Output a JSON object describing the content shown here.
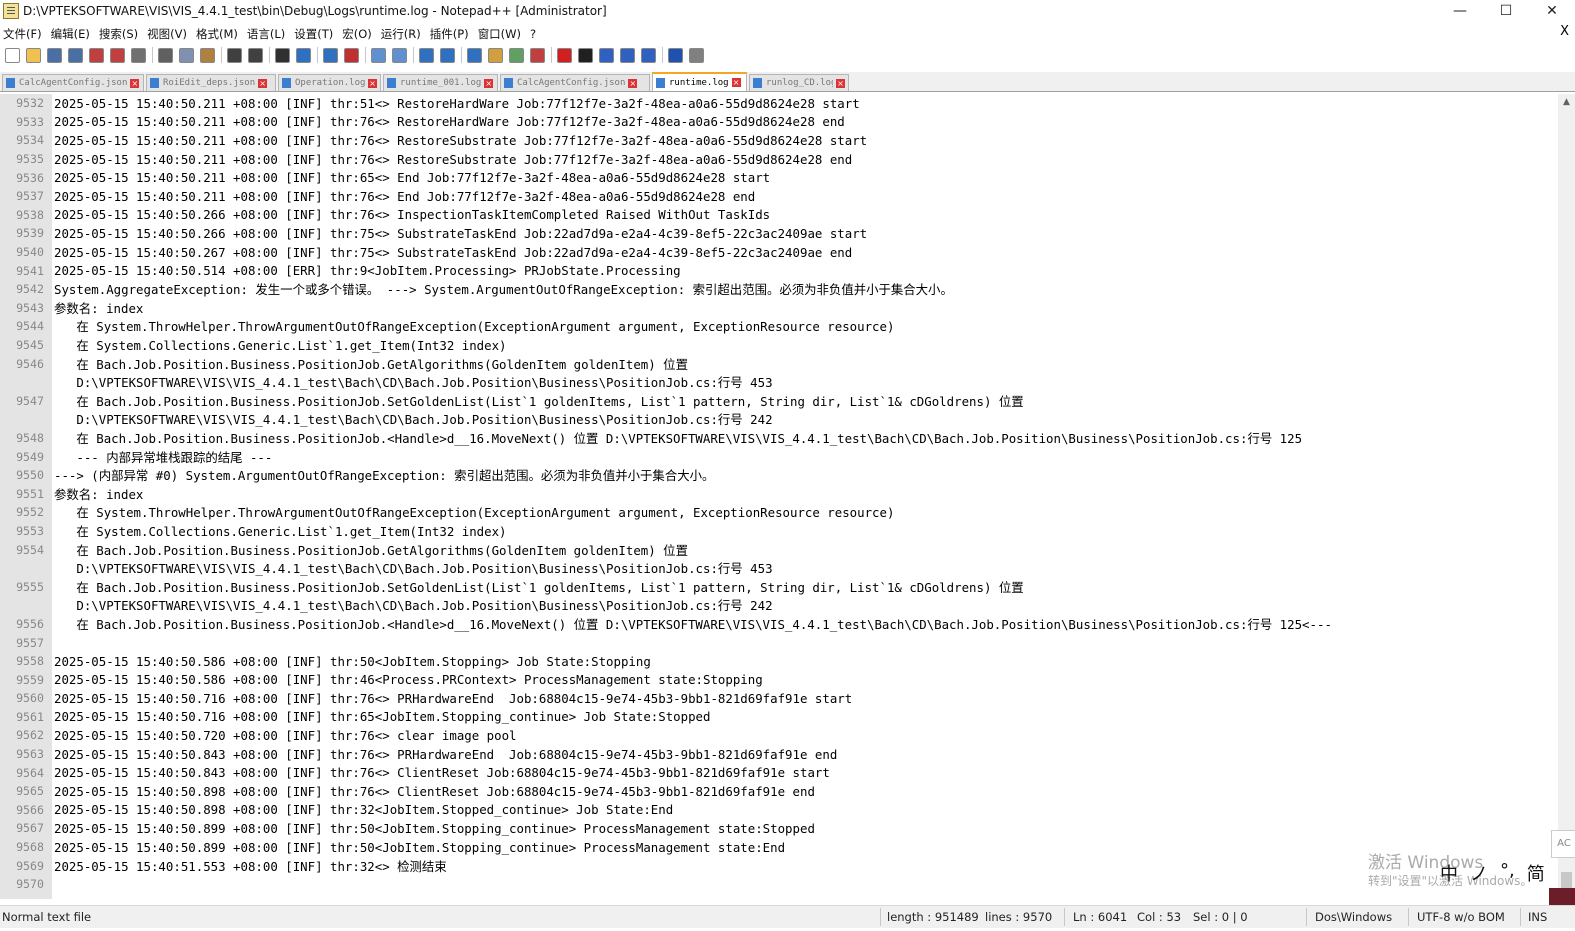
{
  "window": {
    "title": "D:\\VPTEKSOFTWARE\\VIS\\VIS_4.4.1_test\\bin\\Debug\\Logs\\runtime.log - Notepad++ [Administrator]",
    "minimize": "—",
    "maximize": "☐",
    "close": "✕"
  },
  "menu": [
    "文件(F)",
    "编辑(E)",
    "搜索(S)",
    "视图(V)",
    "格式(M)",
    "语言(L)",
    "设置(T)",
    "宏(O)",
    "运行(R)",
    "插件(P)",
    "窗口(W)",
    "?"
  ],
  "menu_close": "X",
  "toolbar": [
    {
      "icon": "new-file-icon",
      "color": "#ffffff"
    },
    {
      "icon": "open-file-icon",
      "color": "#f0c050"
    },
    {
      "icon": "save-icon",
      "color": "#4a6fa5"
    },
    {
      "icon": "save-all-icon",
      "color": "#4a6fa5"
    },
    {
      "icon": "close-file-icon",
      "color": "#c04040"
    },
    {
      "icon": "close-all-icon",
      "color": "#c04040"
    },
    {
      "icon": "print-icon",
      "color": "#707070"
    },
    {
      "icon": "sep"
    },
    {
      "icon": "cut-icon",
      "color": "#606060"
    },
    {
      "icon": "copy-icon",
      "color": "#8090b0"
    },
    {
      "icon": "paste-icon",
      "color": "#b08040"
    },
    {
      "icon": "sep"
    },
    {
      "icon": "undo-icon",
      "color": "#404040"
    },
    {
      "icon": "redo-icon",
      "color": "#404040"
    },
    {
      "icon": "sep"
    },
    {
      "icon": "find-icon",
      "color": "#303030"
    },
    {
      "icon": "replace-icon",
      "color": "#3070c0"
    },
    {
      "icon": "sep"
    },
    {
      "icon": "zoom-in-icon",
      "color": "#3070c0"
    },
    {
      "icon": "zoom-out-icon",
      "color": "#c03030"
    },
    {
      "icon": "sep"
    },
    {
      "icon": "sync-vertical-icon",
      "color": "#6090d0"
    },
    {
      "icon": "sync-horizontal-icon",
      "color": "#6090d0"
    },
    {
      "icon": "sep"
    },
    {
      "icon": "word-wrap-icon",
      "color": "#3070c0"
    },
    {
      "icon": "show-all-chars-icon",
      "color": "#3070c0"
    },
    {
      "icon": "sep"
    },
    {
      "icon": "indent-guide-icon",
      "color": "#3070c0"
    },
    {
      "icon": "udl-icon",
      "color": "#d0a040"
    },
    {
      "icon": "doc-map-icon",
      "color": "#60a060"
    },
    {
      "icon": "function-list-icon",
      "color": "#c04040"
    },
    {
      "icon": "sep"
    },
    {
      "icon": "record-macro-icon",
      "color": "#d02020"
    },
    {
      "icon": "stop-macro-icon",
      "color": "#202020"
    },
    {
      "icon": "play-macro-icon",
      "color": "#3060c0"
    },
    {
      "icon": "run-macro-multiple-icon",
      "color": "#3060c0"
    },
    {
      "icon": "save-macro-icon",
      "color": "#3060c0"
    },
    {
      "icon": "sep"
    },
    {
      "icon": "spellcheck-icon",
      "color": "#2050b0"
    },
    {
      "icon": "plugin-icon",
      "color": "#808080"
    }
  ],
  "tabs": [
    {
      "label": "CalcAgentConfig.json",
      "active": false
    },
    {
      "label": "RoiEdit_deps.json",
      "active": false
    },
    {
      "label": "Operation.log",
      "active": false
    },
    {
      "label": "runtime_001.log",
      "active": false
    },
    {
      "label": "CalcAgentConfig.json",
      "active": false
    },
    {
      "label": "runtime.log",
      "active": true
    },
    {
      "label": "runlog_CD.log",
      "active": false
    }
  ],
  "lines": [
    {
      "n": "9532",
      "t": "2025-05-15 15:40:50.211 +08:00 [INF] thr:51<> RestoreHardWare Job:77f12f7e-3a2f-48ea-a0a6-55d9d8624e28 start"
    },
    {
      "n": "9533",
      "t": "2025-05-15 15:40:50.211 +08:00 [INF] thr:76<> RestoreHardWare Job:77f12f7e-3a2f-48ea-a0a6-55d9d8624e28 end"
    },
    {
      "n": "9534",
      "t": "2025-05-15 15:40:50.211 +08:00 [INF] thr:76<> RestoreSubstrate Job:77f12f7e-3a2f-48ea-a0a6-55d9d8624e28 start"
    },
    {
      "n": "9535",
      "t": "2025-05-15 15:40:50.211 +08:00 [INF] thr:76<> RestoreSubstrate Job:77f12f7e-3a2f-48ea-a0a6-55d9d8624e28 end"
    },
    {
      "n": "9536",
      "t": "2025-05-15 15:40:50.211 +08:00 [INF] thr:65<> End Job:77f12f7e-3a2f-48ea-a0a6-55d9d8624e28 start"
    },
    {
      "n": "9537",
      "t": "2025-05-15 15:40:50.211 +08:00 [INF] thr:76<> End Job:77f12f7e-3a2f-48ea-a0a6-55d9d8624e28 end"
    },
    {
      "n": "9538",
      "t": "2025-05-15 15:40:50.266 +08:00 [INF] thr:76<> InspectionTaskItemCompleted Raised WithOut TaskIds"
    },
    {
      "n": "9539",
      "t": "2025-05-15 15:40:50.266 +08:00 [INF] thr:75<> SubstrateTaskEnd Job:22ad7d9a-e2a4-4c39-8ef5-22c3ac2409ae start"
    },
    {
      "n": "9540",
      "t": "2025-05-15 15:40:50.267 +08:00 [INF] thr:75<> SubstrateTaskEnd Job:22ad7d9a-e2a4-4c39-8ef5-22c3ac2409ae end"
    },
    {
      "n": "9541",
      "t": "2025-05-15 15:40:50.514 +08:00 [ERR] thr:9<JobItem.Processing> PRJobState.Processing"
    },
    {
      "n": "9542",
      "t": "System.AggregateException: 发生一个或多个错误。 ---> System.ArgumentOutOfRangeException: 索引超出范围。必须为非负值并小于集合大小。"
    },
    {
      "n": "9543",
      "t": "参数名: index"
    },
    {
      "n": "9544",
      "t": "   在 System.ThrowHelper.ThrowArgumentOutOfRangeException(ExceptionArgument argument, ExceptionResource resource)"
    },
    {
      "n": "9545",
      "t": "   在 System.Collections.Generic.List`1.get_Item(Int32 index)"
    },
    {
      "n": "9546",
      "t": "   在 Bach.Job.Position.Business.PositionJob.GetAlgorithms(GoldenItem goldenItem) 位置"
    },
    {
      "n": "",
      "t": "   D:\\VPTEKSOFTWARE\\VIS\\VIS_4.4.1_test\\Bach\\CD\\Bach.Job.Position\\Business\\PositionJob.cs:行号 453"
    },
    {
      "n": "9547",
      "t": "   在 Bach.Job.Position.Business.PositionJob.SetGoldenList(List`1 goldenItems, List`1 pattern, String dir, List`1& cDGoldrens) 位置"
    },
    {
      "n": "",
      "t": "   D:\\VPTEKSOFTWARE\\VIS\\VIS_4.4.1_test\\Bach\\CD\\Bach.Job.Position\\Business\\PositionJob.cs:行号 242"
    },
    {
      "n": "9548",
      "t": "   在 Bach.Job.Position.Business.PositionJob.<Handle>d__16.MoveNext() 位置 D:\\VPTEKSOFTWARE\\VIS\\VIS_4.4.1_test\\Bach\\CD\\Bach.Job.Position\\Business\\PositionJob.cs:行号 125"
    },
    {
      "n": "9549",
      "t": "   --- 内部异常堆栈跟踪的结尾 ---"
    },
    {
      "n": "9550",
      "t": "---> (内部异常 #0) System.ArgumentOutOfRangeException: 索引超出范围。必须为非负值并小于集合大小。"
    },
    {
      "n": "9551",
      "t": "参数名: index"
    },
    {
      "n": "9552",
      "t": "   在 System.ThrowHelper.ThrowArgumentOutOfRangeException(ExceptionArgument argument, ExceptionResource resource)"
    },
    {
      "n": "9553",
      "t": "   在 System.Collections.Generic.List`1.get_Item(Int32 index)"
    },
    {
      "n": "9554",
      "t": "   在 Bach.Job.Position.Business.PositionJob.GetAlgorithms(GoldenItem goldenItem) 位置"
    },
    {
      "n": "",
      "t": "   D:\\VPTEKSOFTWARE\\VIS\\VIS_4.4.1_test\\Bach\\CD\\Bach.Job.Position\\Business\\PositionJob.cs:行号 453"
    },
    {
      "n": "9555",
      "t": "   在 Bach.Job.Position.Business.PositionJob.SetGoldenList(List`1 goldenItems, List`1 pattern, String dir, List`1& cDGoldrens) 位置"
    },
    {
      "n": "",
      "t": "   D:\\VPTEKSOFTWARE\\VIS\\VIS_4.4.1_test\\Bach\\CD\\Bach.Job.Position\\Business\\PositionJob.cs:行号 242"
    },
    {
      "n": "9556",
      "t": "   在 Bach.Job.Position.Business.PositionJob.<Handle>d__16.MoveNext() 位置 D:\\VPTEKSOFTWARE\\VIS\\VIS_4.4.1_test\\Bach\\CD\\Bach.Job.Position\\Business\\PositionJob.cs:行号 125<---"
    },
    {
      "n": "9557",
      "t": ""
    },
    {
      "n": "9558",
      "t": "2025-05-15 15:40:50.586 +08:00 [INF] thr:50<JobItem.Stopping> Job State:Stopping"
    },
    {
      "n": "9559",
      "t": "2025-05-15 15:40:50.586 +08:00 [INF] thr:46<Process.PRContext> ProcessManagement state:Stopping"
    },
    {
      "n": "9560",
      "t": "2025-05-15 15:40:50.716 +08:00 [INF] thr:76<> PRHardwareEnd  Job:68804c15-9e74-45b3-9bb1-821d69faf91e start"
    },
    {
      "n": "9561",
      "t": "2025-05-15 15:40:50.716 +08:00 [INF] thr:65<JobItem.Stopping_continue> Job State:Stopped"
    },
    {
      "n": "9562",
      "t": "2025-05-15 15:40:50.720 +08:00 [INF] thr:76<> clear image pool"
    },
    {
      "n": "9563",
      "t": "2025-05-15 15:40:50.843 +08:00 [INF] thr:76<> PRHardwareEnd  Job:68804c15-9e74-45b3-9bb1-821d69faf91e end"
    },
    {
      "n": "9564",
      "t": "2025-05-15 15:40:50.843 +08:00 [INF] thr:76<> ClientReset Job:68804c15-9e74-45b3-9bb1-821d69faf91e start"
    },
    {
      "n": "9565",
      "t": "2025-05-15 15:40:50.898 +08:00 [INF] thr:76<> ClientReset Job:68804c15-9e74-45b3-9bb1-821d69faf91e end"
    },
    {
      "n": "9566",
      "t": "2025-05-15 15:40:50.898 +08:00 [INF] thr:32<JobItem.Stopped_continue> Job State:End"
    },
    {
      "n": "9567",
      "t": "2025-05-15 15:40:50.899 +08:00 [INF] thr:50<JobItem.Stopping_continue> ProcessManagement state:Stopped"
    },
    {
      "n": "9568",
      "t": "2025-05-15 15:40:50.899 +08:00 [INF] thr:50<JobItem.Stopping_continue> ProcessManagement state:End"
    },
    {
      "n": "9569",
      "t": "2025-05-15 15:40:51.553 +08:00 [INF] thr:32<> 检测结束"
    },
    {
      "n": "9570",
      "t": ""
    }
  ],
  "watermark": {
    "line1": "激活 Windows",
    "line2": "转到\"设置\"以激活 Windows。"
  },
  "ime": [
    "中",
    "ノ",
    "°,",
    "简"
  ],
  "side_badge": "AC",
  "status": {
    "file_type": "Normal text file",
    "length": "length : 951489",
    "lines": "lines : 9570",
    "ln": "Ln : 6041",
    "col": "Col : 53",
    "sel": "Sel : 0 | 0",
    "eol": "Dos\\Windows",
    "encoding": "UTF-8 w/o BOM",
    "mode": "INS"
  }
}
